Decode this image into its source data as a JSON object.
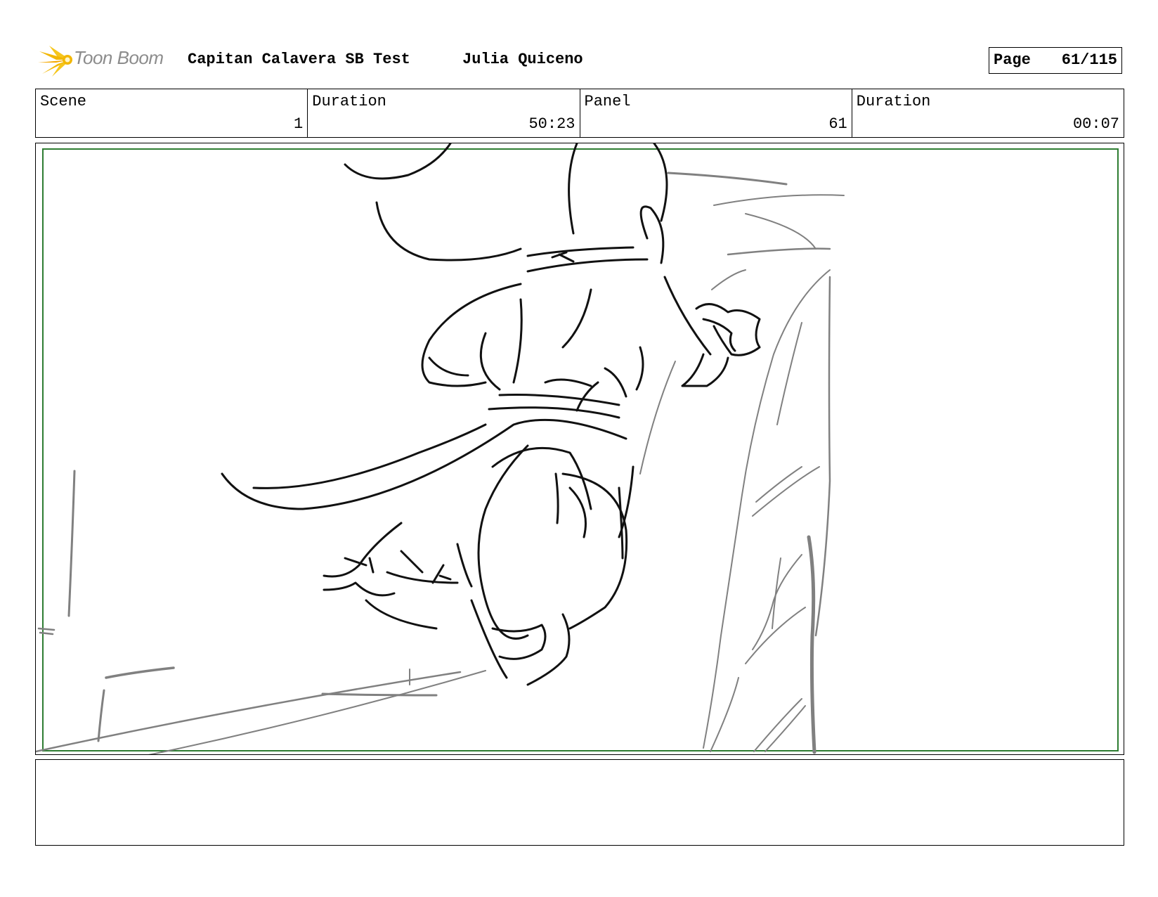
{
  "header": {
    "logo_text": "Toon Boom",
    "project_title": "Capitan Calavera SB Test",
    "author": "Julia Quiceno",
    "page_label": "Page",
    "page_value": "61/115"
  },
  "info": {
    "scene_label": "Scene",
    "scene_value": "1",
    "scene_duration_label": "Duration",
    "scene_duration_value": "50:23",
    "panel_label": "Panel",
    "panel_value": "61",
    "panel_duration_label": "Duration",
    "panel_duration_value": "00:07"
  },
  "panel": {
    "safe_frame_color": "#2e7d32",
    "sketch_line_color": "#111111",
    "background_line_color": "#808080"
  },
  "notes": {
    "text": ""
  },
  "colors": {
    "logo_flare": "#f2b705",
    "logo_text": "#8c8c8c",
    "border": "#000000"
  }
}
